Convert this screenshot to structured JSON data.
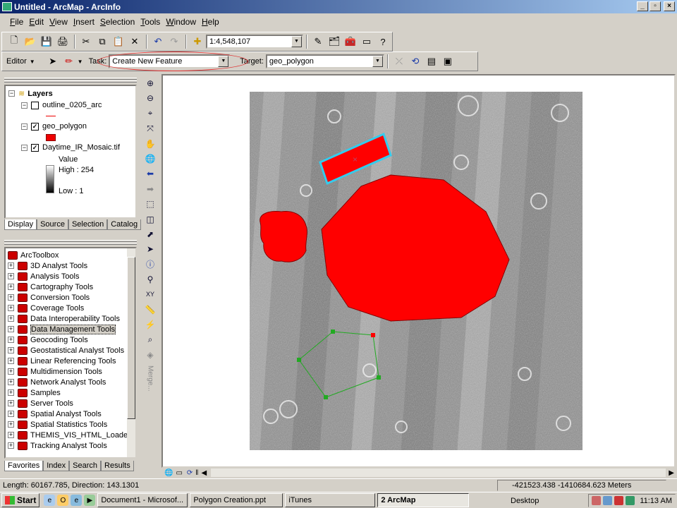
{
  "window": {
    "title": "Untitled - ArcMap - ArcInfo",
    "minimize": "_",
    "restore": "▫",
    "close": "×"
  },
  "menu": [
    "File",
    "Edit",
    "View",
    "Insert",
    "Selection",
    "Tools",
    "Window",
    "Help"
  ],
  "standard_toolbar": {
    "scale_value": "1:4,548,107"
  },
  "editor_toolbar": {
    "editor_label": "Editor",
    "task_label": "Task:",
    "task_value": "Create New Feature",
    "target_label": "Target:",
    "target_value": "geo_polygon"
  },
  "toc": {
    "root": "Layers",
    "layers": [
      {
        "name": "outline_0205_arc",
        "checked": false
      },
      {
        "name": "geo_polygon",
        "checked": true
      },
      {
        "name": "Daytime_IR_Mosaic.tif",
        "checked": true
      }
    ],
    "legend_value_label": "Value",
    "legend_high": "High : 254",
    "legend_low": "Low : 1",
    "tabs": [
      "Display",
      "Source",
      "Selection",
      "Catalog"
    ]
  },
  "toolbox": {
    "root": "ArcToolbox",
    "items": [
      "3D Analyst Tools",
      "Analysis Tools",
      "Cartography Tools",
      "Conversion Tools",
      "Coverage Tools",
      "Data Interoperability Tools",
      "Data Management Tools",
      "Geocoding Tools",
      "Geostatistical Analyst Tools",
      "Linear Referencing Tools",
      "Multidimension Tools",
      "Network Analyst Tools",
      "Samples",
      "Server Tools",
      "Spatial Analyst Tools",
      "Spatial Statistics Tools",
      "THEMIS_VIS_HTML_Loader_",
      "Tracking Analyst Tools"
    ],
    "selected_index": 6,
    "tabs": [
      "Favorites",
      "Index",
      "Search",
      "Results"
    ]
  },
  "vertical_tools": {
    "merge_label": "Merge..."
  },
  "status": {
    "left": "Length: 60167.785, Direction: 143.1301",
    "right": "-421523.438  -1410684.623 Meters"
  },
  "taskbar": {
    "start": "Start",
    "tasks": [
      "Document1 - Microsof...",
      "Polygon Creation.ppt",
      "iTunes",
      "2 ArcMap"
    ],
    "active_task_index": 3,
    "desktop": "Desktop",
    "time": "11:13 AM"
  },
  "colors": {
    "polygon_fill": "#ff0000",
    "selection_outline": "#33ccee",
    "sketch": "#22aa22",
    "accent_ellipse": "#e03030"
  }
}
